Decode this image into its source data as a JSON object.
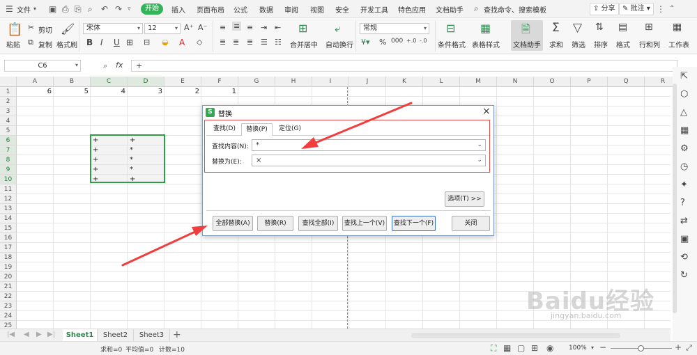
{
  "menu": {
    "file": "文件",
    "tabs": [
      "开始",
      "插入",
      "页面布局",
      "公式",
      "数据",
      "审阅",
      "视图",
      "安全",
      "开发工具",
      "特色应用",
      "文档助手"
    ],
    "search": "查找命令、搜索模板",
    "share": "分享",
    "comment": "批注"
  },
  "ribbon": {
    "paste": "粘贴",
    "cut": "剪切",
    "copy": "复制",
    "format_painter": "格式刷",
    "font": "宋体",
    "font_size": "12",
    "merge_center": "合并居中",
    "wrap_text": "自动换行",
    "number_format": "常规",
    "conditional_format": "条件格式",
    "table_style": "表格样式",
    "doc_assistant": "文档助手",
    "sum": "求和",
    "filter": "筛选",
    "sort": "排序",
    "format": "格式",
    "row_col": "行和列",
    "worksheet": "工作表"
  },
  "formula_bar": {
    "name_box": "C6",
    "fx": "fx",
    "content": "+"
  },
  "columns": [
    "A",
    "B",
    "C",
    "D",
    "E",
    "F",
    "G",
    "H",
    "I",
    "J",
    "K",
    "L",
    "M",
    "N",
    "O",
    "P",
    "Q",
    "R"
  ],
  "rows": [
    "1",
    "2",
    "3",
    "4",
    "5",
    "6",
    "7",
    "8",
    "9",
    "10",
    "11",
    "12",
    "13",
    "14",
    "15",
    "16",
    "17",
    "18",
    "19",
    "20",
    "21",
    "22",
    "23",
    "24",
    "25"
  ],
  "row1_values": [
    "6",
    "5",
    "4",
    "3",
    "2",
    "1"
  ],
  "col_c_values": [
    "+",
    "+",
    "+",
    "+",
    "+"
  ],
  "col_d_values": [
    "+",
    "*",
    "*",
    "*",
    "+"
  ],
  "sheets": [
    "Sheet1",
    "Sheet2",
    "Sheet3"
  ],
  "status": {
    "sum": "求和=0",
    "avg": "平均值=0",
    "count": "计数=10",
    "zoom": "100%"
  },
  "dialog": {
    "title": "替换",
    "tabs": [
      "查找(D)",
      "替换(P)",
      "定位(G)"
    ],
    "find_label": "查找内容(N):",
    "find_value": "*",
    "replace_label": "替换为(E):",
    "replace_value": "×",
    "options_btn": "选项(T) >>",
    "buttons": [
      "全部替换(A)",
      "替换(R)",
      "查找全部(I)",
      "查找上一个(V)",
      "查找下一个(F)",
      "关闭"
    ]
  },
  "watermark": {
    "main": "Baidu经验",
    "sub": "jingyan.baidu.com"
  },
  "colors": {
    "accent": "#35b35b",
    "selection": "#2f9d48",
    "arrow": "#f03e3e"
  }
}
